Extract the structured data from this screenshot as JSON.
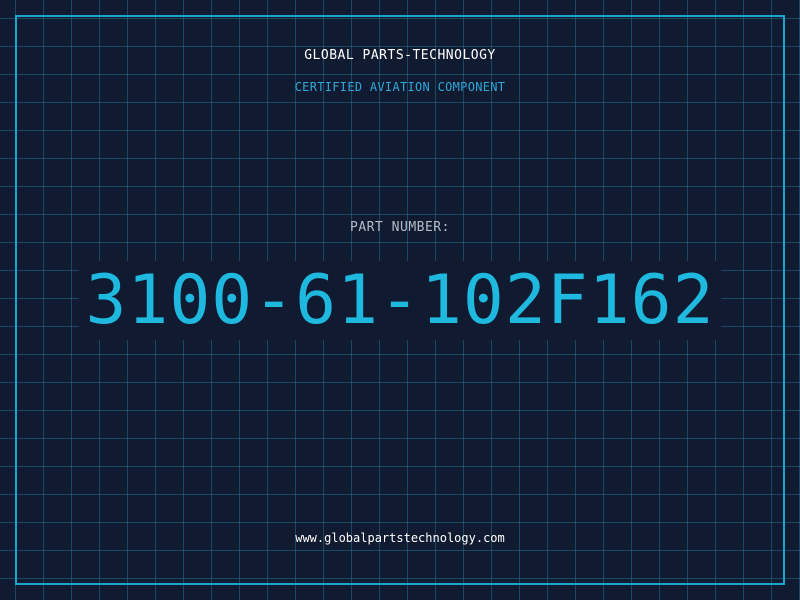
{
  "header": {
    "company_name": "GLOBAL PARTS-TECHNOLOGY",
    "tagline": "CERTIFIED AVIATION COMPONENT"
  },
  "part": {
    "label": "PART NUMBER:",
    "number": "3100-61-102F162"
  },
  "footer": {
    "website": "www.globalpartstechnology.com"
  },
  "colors": {
    "background": "#101a30",
    "accent": "#1fb8de",
    "grid": "#286e8c"
  }
}
